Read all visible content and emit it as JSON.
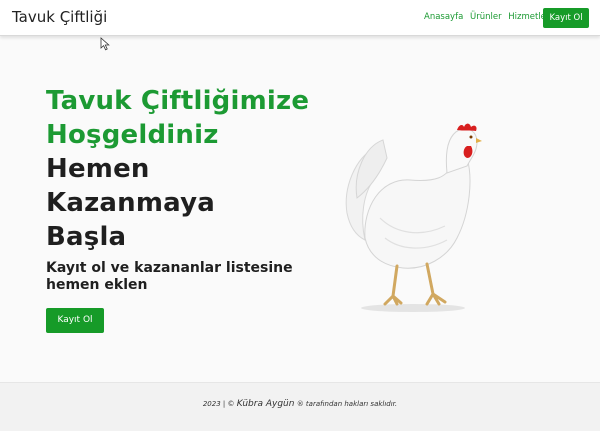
{
  "navbar": {
    "brand": "Tavuk Çiftliği",
    "links": [
      "Anasayfa",
      "Ürünler",
      "Hizmetler"
    ],
    "signup_button": "Kayıt Ol"
  },
  "hero": {
    "heading_green_1": "Tavuk Çiftliğimize",
    "heading_green_2": "Hoşgeldiniz",
    "heading_dark_1": "Hemen",
    "heading_dark_2": "Kazanmaya",
    "heading_dark_3": "Başla",
    "subtitle_1": "Kayıt ol ve kazananlar listesine",
    "subtitle_2": "hemen eklen",
    "signup_button": "Kayıt Ol"
  },
  "footer": {
    "prefix": "2023 | ©",
    "author": "Kübra Aygün",
    "suffix": "® tarafından hakları saklıdır."
  },
  "colors": {
    "accent": "#1c9a33",
    "button": "#169b28",
    "text_dark": "#1f1f1f"
  },
  "icons": {
    "cursor": "mouse-cursor-icon",
    "image": "white-hen-image"
  }
}
